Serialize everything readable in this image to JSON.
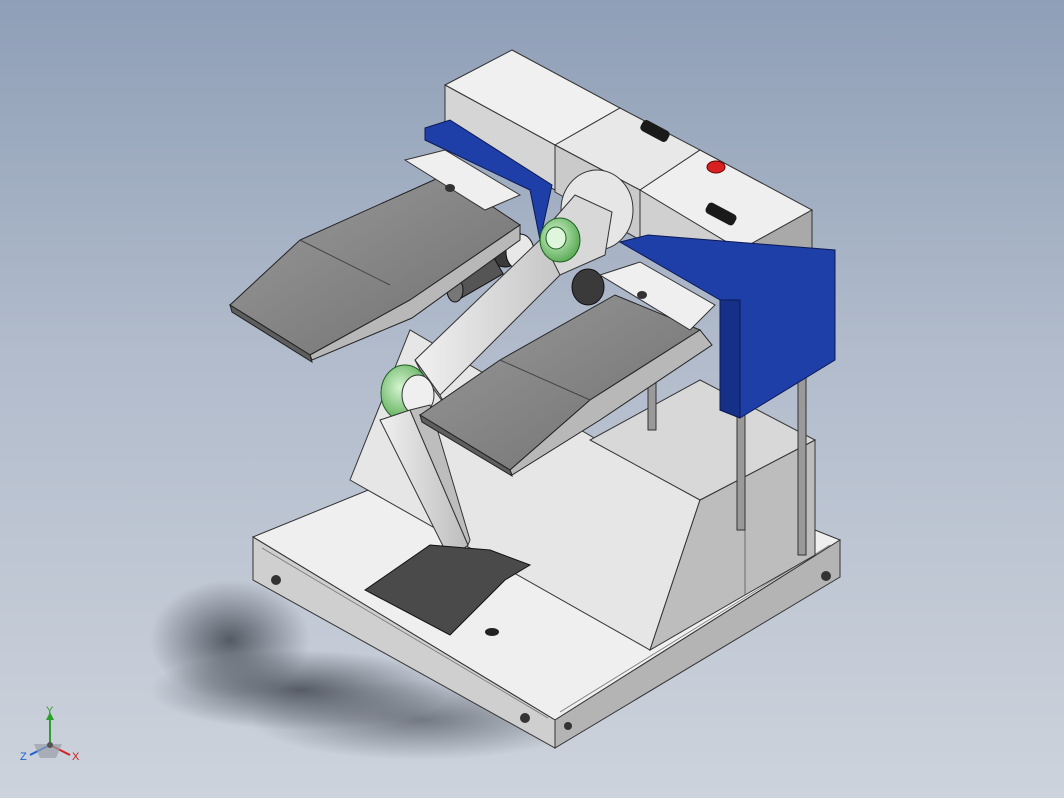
{
  "viewport": {
    "background_top": "#8f9fb7",
    "background_bottom": "#cdd3dc"
  },
  "model": {
    "base_plate_color": "#e4e4e4",
    "cabinet_color": "#c8c8c8",
    "blue_bracket_color": "#1f3fa8",
    "arm_color": "#dcdcdc",
    "tray_color": "#8a8a8a",
    "gear_green": "#8fd08a",
    "stop_button_color": "#d82020"
  },
  "triad": {
    "y_label": "Y",
    "z_label": "Z",
    "x_label": "X",
    "y_color": "#2ca02c",
    "z_color": "#1f5fd0",
    "x_color": "#d02020"
  }
}
